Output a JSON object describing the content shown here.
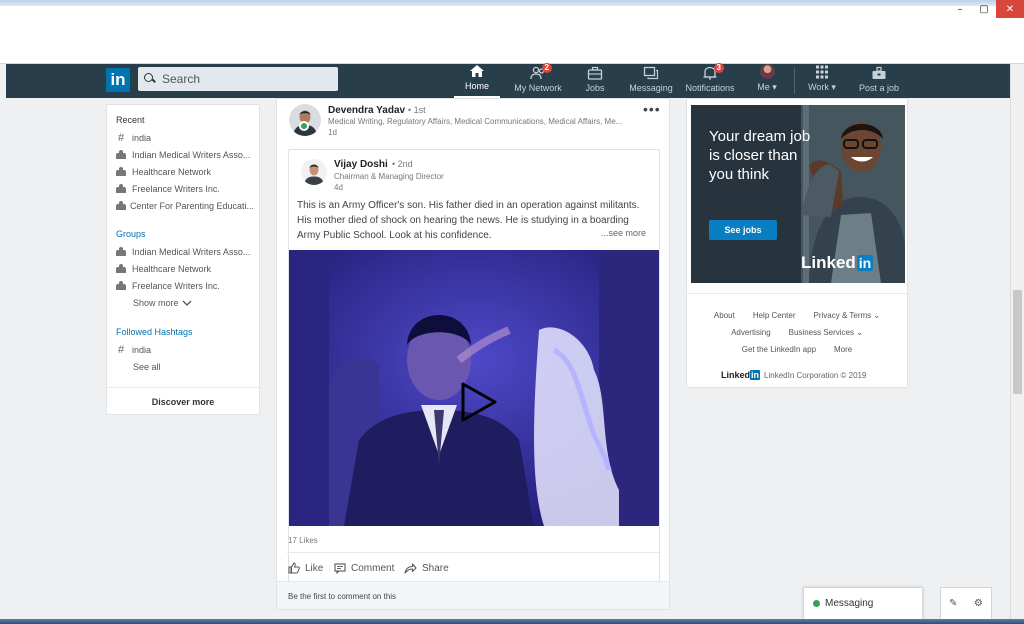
{
  "window": {
    "controls": [
      "–",
      "▢",
      "✕"
    ]
  },
  "nav": {
    "logo": "in",
    "search_placeholder": "Search",
    "items": [
      {
        "label": "Home",
        "icon": "home-icon",
        "active": true,
        "badge": ""
      },
      {
        "label": "My Network",
        "icon": "network-icon",
        "active": false,
        "badge": "2"
      },
      {
        "label": "Jobs",
        "icon": "briefcase-icon",
        "active": false,
        "badge": ""
      },
      {
        "label": "Messaging",
        "icon": "messaging-icon",
        "active": false,
        "badge": ""
      },
      {
        "label": "Notifications",
        "icon": "bell-icon",
        "active": false,
        "badge": "3"
      },
      {
        "label": "Me ▾",
        "icon": "avatar",
        "active": false,
        "badge": ""
      },
      {
        "label": "Work ▾",
        "icon": "grid-icon",
        "active": false,
        "badge": ""
      },
      {
        "label": "Post a job",
        "icon": "post-job-icon",
        "active": false,
        "badge": ""
      }
    ]
  },
  "left": {
    "recent_heading": "Recent",
    "recent": [
      {
        "type": "hashtag",
        "label": "india"
      },
      {
        "type": "group",
        "label": "Indian Medical Writers Asso..."
      },
      {
        "type": "group",
        "label": "Healthcare Network"
      },
      {
        "type": "group",
        "label": "Freelance Writers Inc."
      },
      {
        "type": "group",
        "label": "Center For Parenting Educati..."
      }
    ],
    "groups_heading": "Groups",
    "groups": [
      {
        "label": "Indian Medical Writers Asso..."
      },
      {
        "label": "Healthcare Network"
      },
      {
        "label": "Freelance Writers Inc."
      }
    ],
    "show_more": "Show more",
    "hashtags_heading": "Followed Hashtags",
    "hashtags": [
      "india"
    ],
    "see_all": "See all",
    "discover_more": "Discover more"
  },
  "post": {
    "author": "Devendra Yadav",
    "degree": "• 1st",
    "headline": "Medical Writing, Regulatory Affairs, Medical Communications, Medical Affairs, Me...",
    "time": "1d",
    "more": "•••",
    "shared": {
      "author": "Vijay Doshi",
      "degree": "• 2nd",
      "title": "Chairman & Managing Director",
      "time": "4d",
      "text_line1": "This is an Army Officer's son. His father died in an operation against militants.",
      "text_line2": "His mother died  of shock on hearing the news. He is studying in a boarding",
      "text_line3": "Army Public School. Look at his confidence.",
      "see_more": "...see more"
    },
    "likes": "17 Likes",
    "actions": [
      "Like",
      "Comment",
      "Share"
    ],
    "comment_prompt": "Be the first to comment on this"
  },
  "ad": {
    "headline": "Your dream job is closer than you think",
    "cta": "See jobs",
    "brand": "Linked",
    "brand_in": "in"
  },
  "footer": {
    "row1": [
      "About",
      "Help Center",
      "Privacy & Terms ⌄"
    ],
    "row2": [
      "Advertising",
      "Business Services ⌄"
    ],
    "row3": [
      "Get the LinkedIn app",
      "More"
    ],
    "copyright": "LinkedIn Corporation © 2019",
    "mini_brand": "Linked",
    "mini_in": "in"
  },
  "messaging": {
    "label": "Messaging",
    "tools": [
      "✎",
      "⚙"
    ]
  }
}
